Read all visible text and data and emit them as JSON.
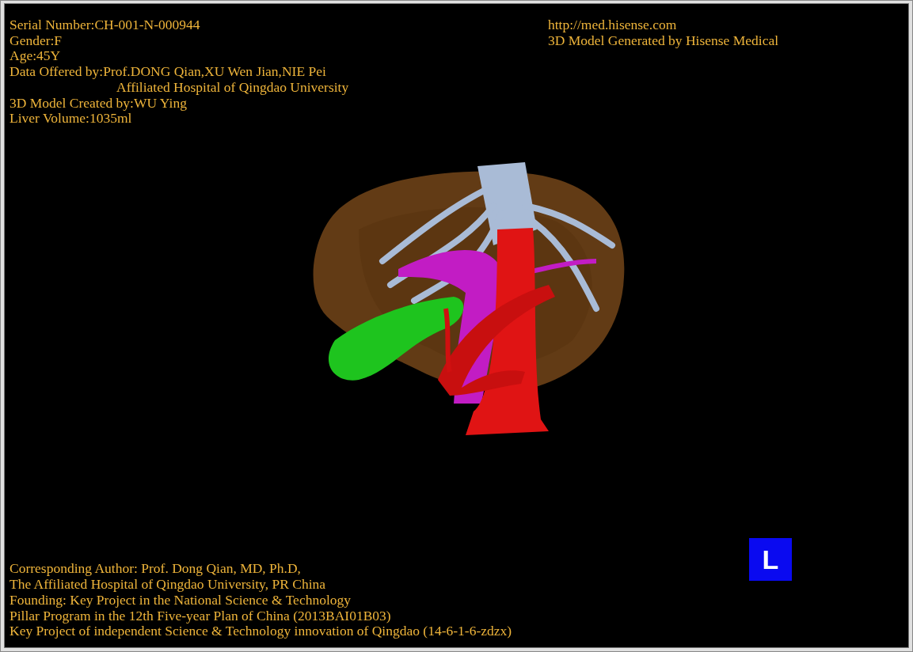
{
  "info_top_left": [
    {
      "kind": "line",
      "text": "Serial Number:CH-001-N-000944"
    },
    {
      "kind": "line",
      "text": "Gender:F"
    },
    {
      "kind": "line",
      "text": "Age:45Y"
    },
    {
      "kind": "line",
      "text": "Data Offered by:Prof.DONG Qian,XU Wen Jian,NIE Pei"
    },
    {
      "kind": "continuation",
      "text": "Affiliated Hospital of Qingdao University"
    },
    {
      "kind": "line",
      "text": "3D Model Created by:WU Ying"
    },
    {
      "kind": "line",
      "text": "Liver Volume:1035ml"
    }
  ],
  "info_top_right": [
    "http://med.hisense.com",
    "3D Model Generated by Hisense Medical"
  ],
  "info_bottom": [
    "Corresponding Author: Prof. Dong Qian, MD, Ph.D,",
    "The Affiliated Hospital of Qingdao University, PR China",
    "Founding: Key Project in the National Science & Technology",
    "Pillar Program in the 12th Five-year Plan of China (2013BAI01B03)",
    "Key Project of independent Science & Technology innovation of Qingdao (14-6-1-6-zdzx)"
  ],
  "orientation_marker": {
    "label": "L"
  }
}
